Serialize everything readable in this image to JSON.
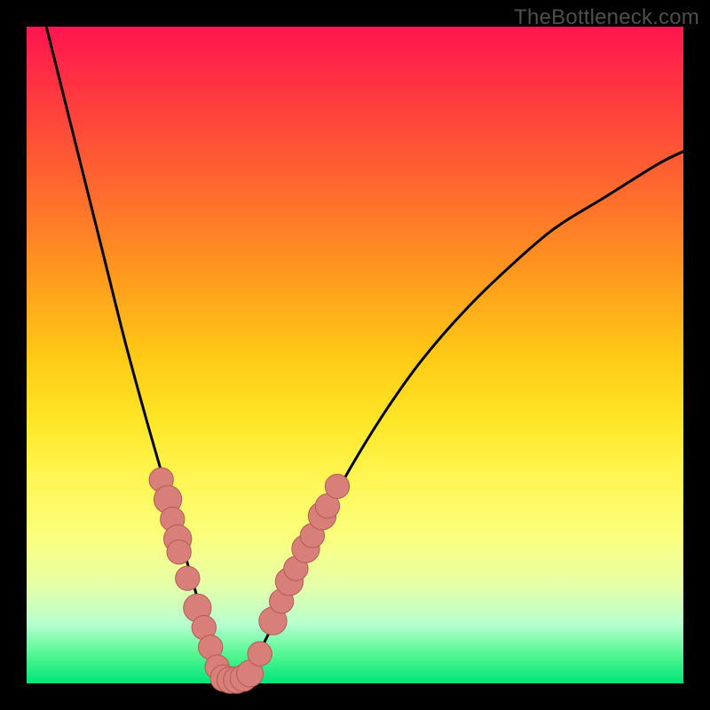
{
  "watermark": "TheBottleneck.com",
  "colors": {
    "frame": "#000000",
    "curve": "#000000",
    "marker_fill": "#d97f79",
    "marker_stroke": "#b35b55",
    "gradient_stops": [
      "#ff154f",
      "#ff3e3e",
      "#ff6a2e",
      "#ff9a1e",
      "#ffc915",
      "#ffe627",
      "#fff85a",
      "#fbff80",
      "#e7ffa8",
      "#b6ffcf",
      "#4cf58e",
      "#00e47a"
    ]
  },
  "chart_data": {
    "type": "line",
    "title": "",
    "xlabel": "",
    "ylabel": "",
    "xlim": [
      0,
      100
    ],
    "ylim": [
      0,
      100
    ],
    "grid": false,
    "legend": false,
    "series": [
      {
        "name": "bottleneck-curve",
        "x": [
          3,
          6,
          9,
          12,
          15,
          18,
          20,
          22,
          24,
          26,
          27.5,
          29,
          30,
          31,
          32,
          33,
          35,
          38,
          41,
          45,
          50,
          55,
          60,
          66,
          72,
          80,
          88,
          96,
          100
        ],
        "y": [
          100,
          88,
          76,
          64,
          52,
          41,
          34,
          27,
          20,
          13,
          8,
          4,
          1,
          0,
          0,
          1,
          4,
          10,
          17,
          25,
          34,
          42,
          49,
          56,
          62,
          69,
          74,
          79,
          81
        ]
      }
    ],
    "markers": [
      {
        "x": 20.5,
        "y": 31,
        "r": 1.3
      },
      {
        "x": 21.5,
        "y": 28,
        "r": 1.6
      },
      {
        "x": 22.2,
        "y": 25,
        "r": 1.3
      },
      {
        "x": 23.0,
        "y": 22,
        "r": 1.6
      },
      {
        "x": 23.2,
        "y": 20,
        "r": 1.3
      },
      {
        "x": 24.5,
        "y": 16,
        "r": 1.3
      },
      {
        "x": 26.0,
        "y": 11.5,
        "r": 1.6
      },
      {
        "x": 27.0,
        "y": 8.5,
        "r": 1.3
      },
      {
        "x": 28.0,
        "y": 5.5,
        "r": 1.3
      },
      {
        "x": 29.0,
        "y": 2.5,
        "r": 1.3
      },
      {
        "x": 30.0,
        "y": 0.8,
        "r": 1.5
      },
      {
        "x": 31.0,
        "y": 0.5,
        "r": 1.5
      },
      {
        "x": 32.0,
        "y": 0.5,
        "r": 1.5
      },
      {
        "x": 33.0,
        "y": 0.8,
        "r": 1.5
      },
      {
        "x": 34.0,
        "y": 1.5,
        "r": 1.5
      },
      {
        "x": 35.5,
        "y": 4.5,
        "r": 1.3
      },
      {
        "x": 37.5,
        "y": 9.5,
        "r": 1.6
      },
      {
        "x": 38.8,
        "y": 12.5,
        "r": 1.3
      },
      {
        "x": 40.0,
        "y": 15.5,
        "r": 1.6
      },
      {
        "x": 41.0,
        "y": 17.5,
        "r": 1.3
      },
      {
        "x": 42.5,
        "y": 20.5,
        "r": 1.6
      },
      {
        "x": 43.5,
        "y": 22.5,
        "r": 1.3
      },
      {
        "x": 45.0,
        "y": 25.5,
        "r": 1.6
      },
      {
        "x": 45.8,
        "y": 27.0,
        "r": 1.3
      },
      {
        "x": 47.3,
        "y": 30.0,
        "r": 1.3
      }
    ]
  }
}
